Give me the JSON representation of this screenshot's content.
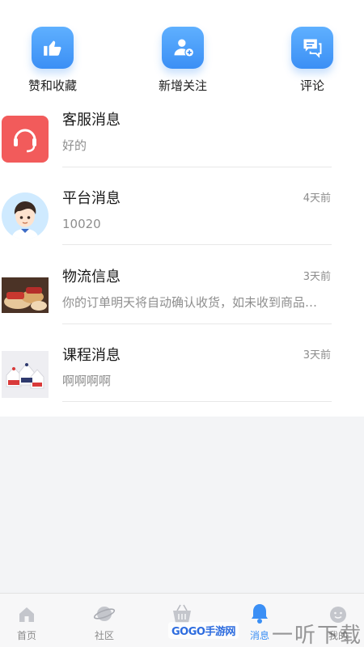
{
  "quick_actions": [
    {
      "label": "赞和收藏",
      "icon": "thumbs-up-icon"
    },
    {
      "label": "新增关注",
      "icon": "add-user-icon"
    },
    {
      "label": "评论",
      "icon": "comment-icon"
    }
  ],
  "messages": [
    {
      "title": "客服消息",
      "subtitle": "好的",
      "time": "",
      "avatar": "headset-avatar"
    },
    {
      "title": "平台消息",
      "subtitle": "10020",
      "time": "4天前",
      "avatar": "boy-avatar"
    },
    {
      "title": "物流信息",
      "subtitle": "你的订单明天将自动确认收货，如未收到商品请及时联系卖家",
      "time": "3天前",
      "avatar": "logistics-photo"
    },
    {
      "title": "课程消息",
      "subtitle": "啊啊啊啊",
      "time": "3天前",
      "avatar": "course-photo"
    }
  ],
  "tabs": [
    {
      "label": "首页",
      "icon": "home-icon",
      "active": false
    },
    {
      "label": "社区",
      "icon": "planet-icon",
      "active": false
    },
    {
      "label": "",
      "icon": "basket-icon",
      "active": false
    },
    {
      "label": "消息",
      "icon": "bell-icon",
      "active": true
    },
    {
      "label": "我的",
      "icon": "smile-icon",
      "active": false
    }
  ],
  "watermark": {
    "site": "GOGO手游网",
    "brand": "一听下载"
  },
  "colors": {
    "accent": "#3b8ff5",
    "service_red": "#f25b5b"
  }
}
